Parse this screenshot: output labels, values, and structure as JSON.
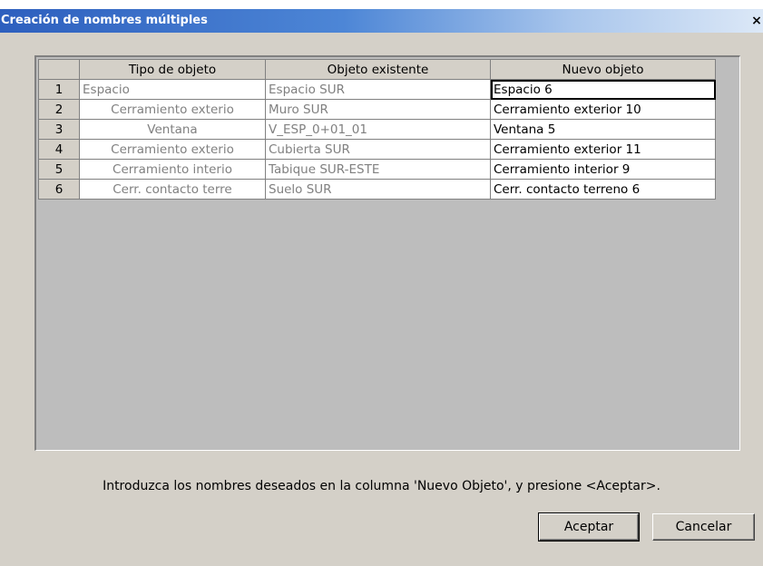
{
  "window": {
    "title": "Creación de nombres múltiples",
    "close_label": "×"
  },
  "table": {
    "headers": [
      "Tipo de objeto",
      "Objeto existente",
      "Nuevo objeto"
    ],
    "rows": [
      {
        "num": "1",
        "tipo": "Espacio",
        "existente": "Espacio SUR",
        "nuevo": "Espacio 6"
      },
      {
        "num": "2",
        "tipo": "Cerramiento exterio",
        "existente": "Muro SUR",
        "nuevo": "Cerramiento exterior 10"
      },
      {
        "num": "3",
        "tipo": "Ventana",
        "existente": "V_ESP_0+01_01",
        "nuevo": "Ventana 5"
      },
      {
        "num": "4",
        "tipo": "Cerramiento exterio",
        "existente": "Cubierta SUR",
        "nuevo": "Cerramiento exterior 11"
      },
      {
        "num": "5",
        "tipo": "Cerramiento interio",
        "existente": "Tabique SUR-ESTE",
        "nuevo": "Cerramiento interior 9"
      },
      {
        "num": "6",
        "tipo": "Cerr. contacto terre",
        "existente": "Suelo SUR",
        "nuevo": "Cerr. contacto terreno 6"
      }
    ]
  },
  "instructions": "Introduzca los nombres deseados en la columna 'Nuevo Objeto', y presione <Aceptar>.",
  "buttons": {
    "ok_label": "Aceptar",
    "cancel_label": "Cancelar"
  },
  "colors": {
    "title_bar": "#2d5fbe",
    "dialog_face": "#d4d0c8",
    "grid_background": "#bdbdbd",
    "disabled_text": "#808080"
  }
}
